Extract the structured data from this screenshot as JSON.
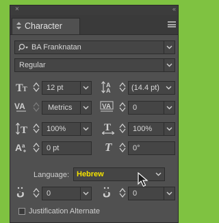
{
  "panel": {
    "title": "Character",
    "close_glyph": "×",
    "collapse_glyph": "«",
    "menu_icon": "panel-menu-icon"
  },
  "font_family": {
    "value": "BA Franknatan"
  },
  "font_style": {
    "value": "Regular"
  },
  "size": {
    "value": "12 pt"
  },
  "leading": {
    "value": "(14.4 pt)"
  },
  "kerning": {
    "value": "Metrics"
  },
  "tracking": {
    "value": "0"
  },
  "vertical_scale": {
    "value": "100%"
  },
  "horizontal_scale": {
    "value": "100%"
  },
  "baseline_shift": {
    "value": "0 pt"
  },
  "skew": {
    "value": "0°"
  },
  "language": {
    "label": "Language:",
    "value": "Hebrew"
  },
  "mark_left": {
    "value": "0"
  },
  "mark_right": {
    "value": "0"
  },
  "justification": {
    "label": "Justification Alternate",
    "checked": false
  }
}
